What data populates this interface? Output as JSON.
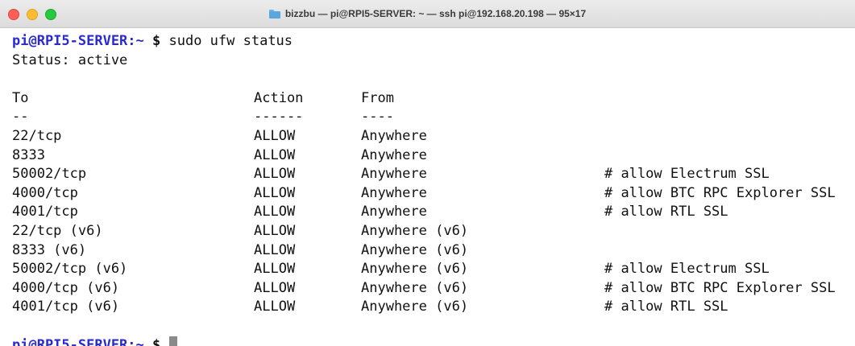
{
  "window": {
    "title": "bizzbu — pi@RPI5-SERVER: ~ — ssh pi@192.168.20.198 — 95×17"
  },
  "prompt": {
    "host": "pi@RPI5-SERVER",
    "path": ":~",
    "symbol": " $"
  },
  "command": " sudo ufw status",
  "status_line": "Status: active",
  "table": {
    "headers": {
      "to": "To",
      "action": "Action",
      "from": "From"
    },
    "separators": {
      "to": "--",
      "action": "------",
      "from": "----"
    },
    "rows": [
      {
        "to": "22/tcp",
        "action": "ALLOW",
        "from": "Anywhere",
        "comment": ""
      },
      {
        "to": "8333",
        "action": "ALLOW",
        "from": "Anywhere",
        "comment": ""
      },
      {
        "to": "50002/tcp",
        "action": "ALLOW",
        "from": "Anywhere",
        "comment": "# allow Electrum SSL"
      },
      {
        "to": "4000/tcp",
        "action": "ALLOW",
        "from": "Anywhere",
        "comment": "# allow BTC RPC Explorer SSL"
      },
      {
        "to": "4001/tcp",
        "action": "ALLOW",
        "from": "Anywhere",
        "comment": "# allow RTL SSL"
      },
      {
        "to": "22/tcp (v6)",
        "action": "ALLOW",
        "from": "Anywhere (v6)",
        "comment": ""
      },
      {
        "to": "8333 (v6)",
        "action": "ALLOW",
        "from": "Anywhere (v6)",
        "comment": ""
      },
      {
        "to": "50002/tcp (v6)",
        "action": "ALLOW",
        "from": "Anywhere (v6)",
        "comment": "# allow Electrum SSL"
      },
      {
        "to": "4000/tcp (v6)",
        "action": "ALLOW",
        "from": "Anywhere (v6)",
        "comment": "# allow BTC RPC Explorer SSL"
      },
      {
        "to": "4001/tcp (v6)",
        "action": "ALLOW",
        "from": "Anywhere (v6)",
        "comment": "# allow RTL SSL"
      }
    ]
  },
  "colors": {
    "prompt": "#2a2ad0",
    "text": "#111111",
    "cursor": "#8a8a8a"
  },
  "icons": {
    "titlebar": "folder-icon"
  }
}
